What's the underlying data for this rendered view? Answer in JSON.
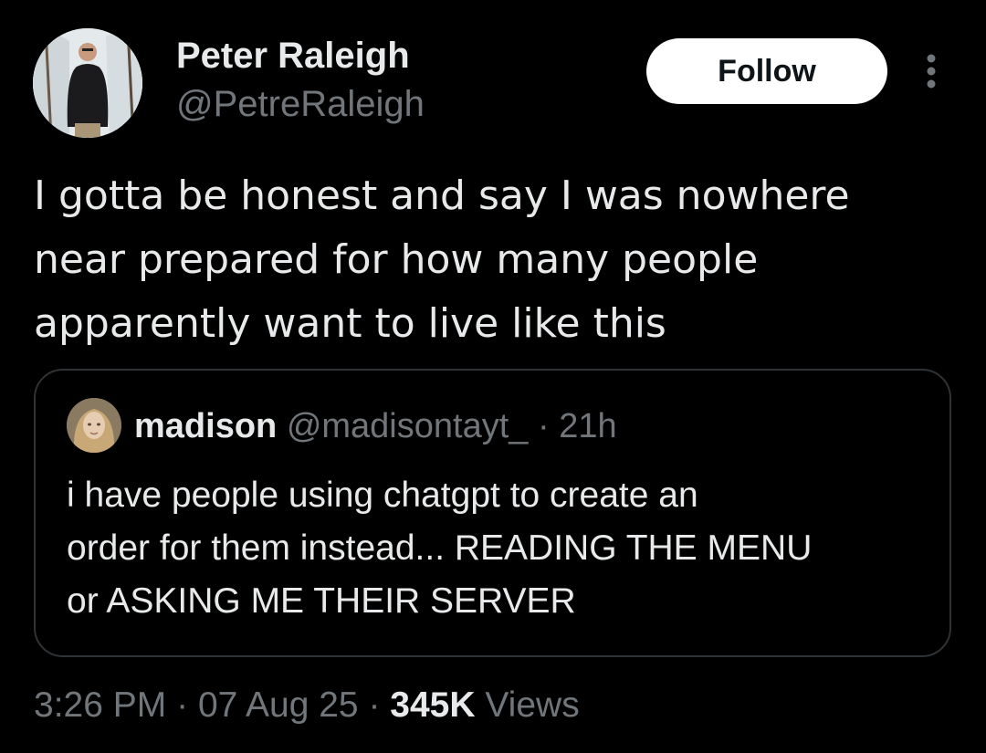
{
  "author": {
    "name": "Peter Raleigh",
    "handle": "@PetreRaleigh",
    "avatar_icon": "user-avatar-photo"
  },
  "header_actions": {
    "follow_label": "Follow",
    "more_icon": "more-vertical-icon"
  },
  "tweet": {
    "lines": [
      "I gotta be honest and say I was nowhere",
      "near prepared for how many people",
      "apparently want to live like this"
    ]
  },
  "quote": {
    "name": "madison",
    "handle": "@madisontayt_",
    "separator": "·",
    "time": "21h",
    "avatar_icon": "user-avatar-photo",
    "lines": [
      "i have people using chatgpt to create an",
      "order for them instead... READING THE MENU",
      "or ASKING ME THEIR SERVER"
    ]
  },
  "meta": {
    "time": "3:26 PM",
    "separator": "·",
    "date": "07 Aug 25",
    "views_count": "345K",
    "views_label": "Views"
  },
  "colors": {
    "background": "#000000",
    "primary_text": "#e7e9ea",
    "secondary_text": "#71767b",
    "border": "#2f3336",
    "follow_bg": "#ffffff"
  }
}
